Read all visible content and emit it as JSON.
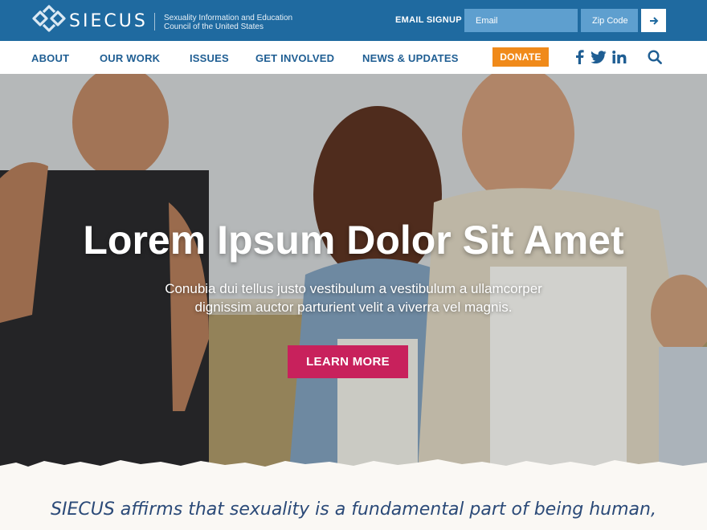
{
  "header": {
    "brand": "SIECUS",
    "tagline_line1": "Sexuality Information and Education",
    "tagline_line2": "Council of the United States",
    "email_signup_label": "EMAIL SIGNUP",
    "email_placeholder": "Email",
    "zip_placeholder": "Zip Code",
    "submit_icon": "arrow-right-icon"
  },
  "nav": {
    "items": [
      {
        "label": "ABOUT"
      },
      {
        "label": "OUR WORK"
      },
      {
        "label": "ISSUES"
      },
      {
        "label": "GET INVOLVED"
      },
      {
        "label": "NEWS & UPDATES"
      }
    ],
    "donate_label": "DONATE",
    "social_icons": [
      "facebook-icon",
      "twitter-icon",
      "linkedin-icon"
    ],
    "search_icon": "search-icon"
  },
  "hero": {
    "title": "Lorem Ipsum Dolor Sit Amet",
    "subtitle_line1": "Conubia dui tellus justo vestibulum a vestibulum a ullamcorper",
    "subtitle_line2": "dignissim auctor parturient velit a viverra vel magnis.",
    "cta_label": "LEARN MORE"
  },
  "mission": {
    "text": "SIECUS affirms that sexuality is a fundamental part of being human,"
  },
  "colors": {
    "topbar": "#1f6aa0",
    "nav_text": "#1f5e93",
    "donate": "#f08a1a",
    "cta": "#c8215c",
    "mission_text": "#2b4a78"
  }
}
